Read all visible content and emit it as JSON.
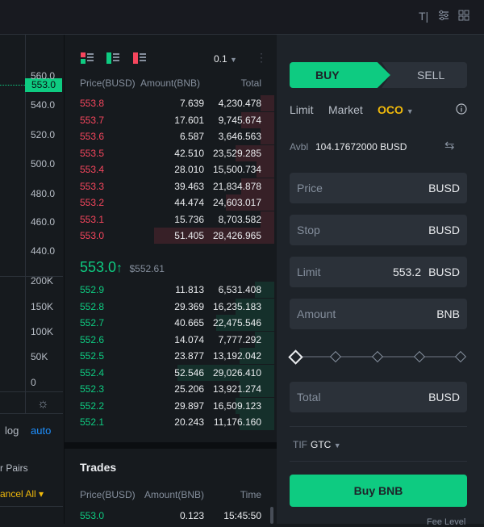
{
  "topbar": {
    "icons": [
      "text-tool-icon",
      "settings-sliders-icon",
      "grid-layout-icon"
    ]
  },
  "chart": {
    "y_labels": [
      "560.0",
      "540.0",
      "520.0",
      "500.0",
      "480.0",
      "460.0",
      "440.0"
    ],
    "current_price": "553.0",
    "volume_labels": [
      "200K",
      "150K",
      "100K",
      "50K",
      "0"
    ],
    "scale_log": "log",
    "scale_auto": "auto",
    "pairs_partial": "r Pairs",
    "cancel_all_partial": "ancel All"
  },
  "orderbook": {
    "precision": "0.1",
    "headers": {
      "price": "Price(BUSD)",
      "amount": "Amount(BNB)",
      "total": "Total"
    },
    "asks": [
      {
        "price": "553.8",
        "amount": "7.639",
        "total": "4,230.478",
        "depth": 0.07
      },
      {
        "price": "553.7",
        "amount": "17.601",
        "total": "9,745.674",
        "depth": 0.17
      },
      {
        "price": "553.6",
        "amount": "6.587",
        "total": "3,646.563",
        "depth": 0.07
      },
      {
        "price": "553.5",
        "amount": "42.510",
        "total": "23,529.285",
        "depth": 0.2
      },
      {
        "price": "553.4",
        "amount": "28.010",
        "total": "15,500.734",
        "depth": 0.09
      },
      {
        "price": "553.3",
        "amount": "39.463",
        "total": "21,834.878",
        "depth": 0.17
      },
      {
        "price": "553.2",
        "amount": "44.474",
        "total": "24,603.017",
        "depth": 0.25
      },
      {
        "price": "553.1",
        "amount": "15.736",
        "total": "8,703.582",
        "depth": 0.07
      },
      {
        "price": "553.0",
        "amount": "51.405",
        "total": "28,426.965",
        "depth": 0.62
      }
    ],
    "mid_price": "553.0",
    "mid_arrow": "↑",
    "mark_price": "$552.61",
    "bids": [
      {
        "price": "552.9",
        "amount": "11.813",
        "total": "6,531.408",
        "depth": 0.1
      },
      {
        "price": "552.8",
        "amount": "29.369",
        "total": "16,235.183",
        "depth": 0.2
      },
      {
        "price": "552.7",
        "amount": "40.665",
        "total": "22,475.546",
        "depth": 0.3
      },
      {
        "price": "552.6",
        "amount": "14.074",
        "total": "7,777.292",
        "depth": 0.1
      },
      {
        "price": "552.5",
        "amount": "23.877",
        "total": "13,192.042",
        "depth": 0.18
      },
      {
        "price": "552.4",
        "amount": "52.546",
        "total": "29,026.410",
        "depth": 0.5
      },
      {
        "price": "552.3",
        "amount": "25.206",
        "total": "13,921.274",
        "depth": 0.18
      },
      {
        "price": "552.2",
        "amount": "29.897",
        "total": "16,509.123",
        "depth": 0.2
      },
      {
        "price": "552.1",
        "amount": "20.243",
        "total": "11,176.160",
        "depth": 0.18
      }
    ]
  },
  "trades": {
    "title": "Trades",
    "headers": {
      "price": "Price(BUSD)",
      "amount": "Amount(BNB)",
      "time": "Time"
    },
    "rows": [
      {
        "price": "553.0",
        "amount": "0.123",
        "time": "15:45:50"
      }
    ]
  },
  "trade_panel": {
    "buy": "BUY",
    "sell": "SELL",
    "tabs": [
      "Limit",
      "Market",
      "OCO"
    ],
    "avbl_label": "Avbl",
    "avbl_value": "104.17672000 BUSD",
    "price_label": "Price",
    "price_unit": "BUSD",
    "stop_label": "Stop",
    "stop_unit": "BUSD",
    "limit_label": "Limit",
    "limit_value": "553.2",
    "limit_unit": "BUSD",
    "amount_label": "Amount",
    "amount_unit": "BNB",
    "slider_level": 0,
    "total_label": "Total",
    "total_unit": "BUSD",
    "tif_label": "TIF",
    "tif_value": "GTC",
    "submit": "Buy BNB",
    "fee_level": "Fee Level",
    "colors": {
      "buy": "#0ecb81",
      "sell": "#f6465d",
      "accent": "#f0b90b"
    }
  }
}
